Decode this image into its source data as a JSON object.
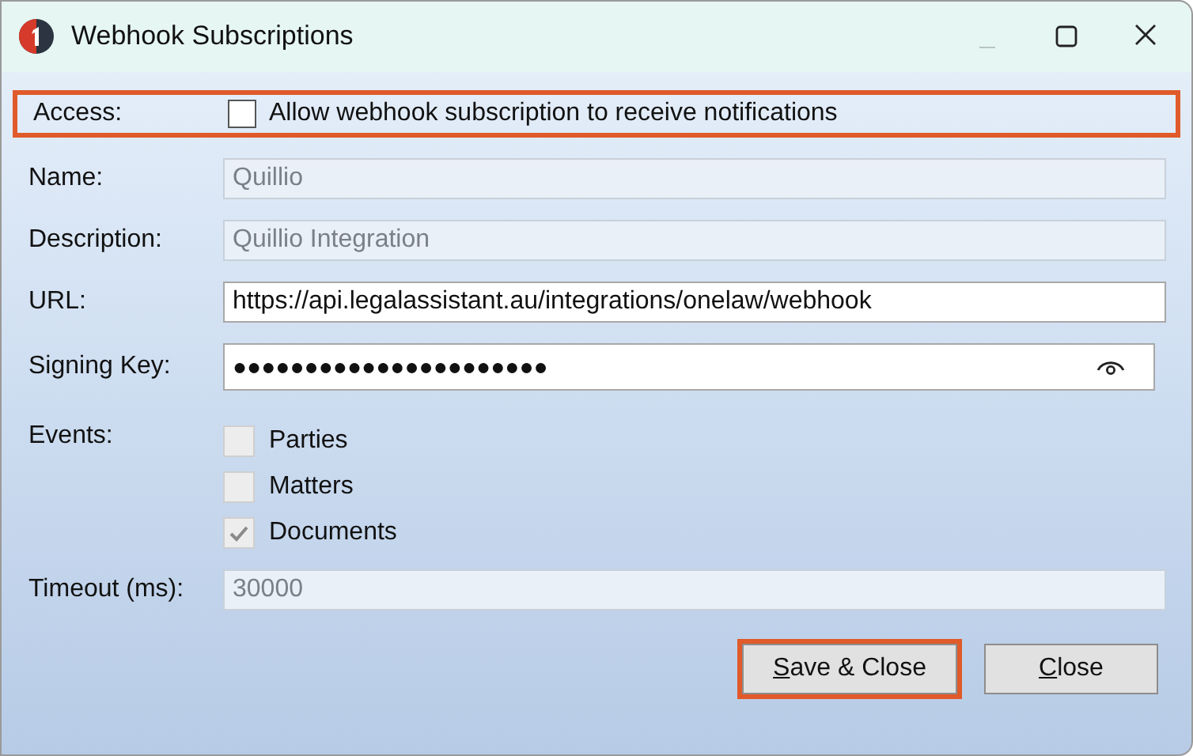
{
  "window": {
    "title": "Webhook Subscriptions"
  },
  "controls": [
    {
      "kind": "minimize",
      "disabled": true
    },
    {
      "kind": "maximize",
      "disabled": false
    },
    {
      "kind": "close",
      "disabled": false
    }
  ],
  "access": {
    "label": "Access:",
    "option": "Allow webhook subscription to receive notifications",
    "checked": false,
    "highlighted": true
  },
  "fields": [
    {
      "kind": "text",
      "label": "Name:",
      "value": "Quillio",
      "disabled": true
    },
    {
      "kind": "text",
      "label": "Description:",
      "value": "Quillio Integration",
      "disabled": true
    },
    {
      "kind": "text",
      "label": "URL:",
      "value": "https://api.legalassistant.au/integrations/onelaw/webhook",
      "disabled": false
    },
    {
      "kind": "password",
      "label": "Signing Key:",
      "value": "●●●●●●●●●●●●●●●●●●●●●●",
      "disabled": false
    }
  ],
  "events": {
    "label": "Events:",
    "items": [
      {
        "label": "Parties",
        "checked": false,
        "disabled": true
      },
      {
        "label": "Matters",
        "checked": false,
        "disabled": true
      },
      {
        "label": "Documents",
        "checked": true,
        "disabled": true
      }
    ]
  },
  "timeout": {
    "label": "Timeout (ms):",
    "value": "30000",
    "disabled": true
  },
  "buttons": [
    {
      "label": "Save & Close",
      "highlighted": true
    },
    {
      "label": "Close",
      "highlighted": false
    }
  ]
}
